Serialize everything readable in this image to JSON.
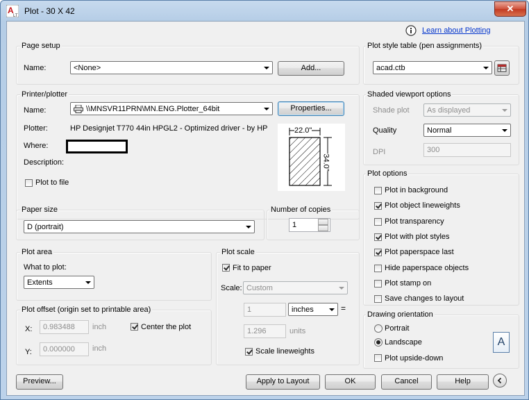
{
  "window": {
    "title": "Plot - 30 X 42",
    "close_glyph": "✕"
  },
  "help_link": "Learn about Plotting",
  "page_setup": {
    "group_label": "Page setup",
    "name_label": "Name:",
    "name_value": "<None>",
    "add_button": "Add..."
  },
  "printer": {
    "group_label": "Printer/plotter",
    "name_label": "Name:",
    "name_value": "\\\\MNSVR11PRN\\MN.ENG.Plotter_64bit",
    "properties_button": "Properties...",
    "plotter_label": "Plotter:",
    "plotter_value": "HP Designjet T770 44in HPGL2 - Optimized driver - by HP",
    "where_label": "Where:",
    "description_label": "Description:",
    "plot_to_file_label": "Plot to file",
    "plot_to_file_checked": false,
    "preview_width": "22.0\"",
    "preview_height": "34.0\""
  },
  "paper_size": {
    "group_label": "Paper size",
    "value": "D (portrait)"
  },
  "copies": {
    "group_label": "Number of copies",
    "value": "1"
  },
  "plot_area": {
    "group_label": "Plot area",
    "what_label": "What to plot:",
    "value": "Extents"
  },
  "plot_offset": {
    "group_label": "Plot offset (origin set to printable area)",
    "x_label": "X:",
    "x_value": "0.983488",
    "x_unit": "inch",
    "y_label": "Y:",
    "y_value": "0.000000",
    "y_unit": "inch",
    "center_label": "Center the plot",
    "center_checked": true
  },
  "plot_scale": {
    "group_label": "Plot scale",
    "fit_label": "Fit to paper",
    "fit_checked": true,
    "scale_label": "Scale:",
    "scale_value": "Custom",
    "num_value": "1",
    "unit_value": "inches",
    "equals": "=",
    "den_value": "1.296",
    "den_unit": "units",
    "lineweights_label": "Scale lineweights",
    "lineweights_checked": true
  },
  "plot_style": {
    "group_label": "Plot style table (pen assignments)",
    "value": "acad.ctb"
  },
  "shaded": {
    "group_label": "Shaded viewport options",
    "shade_label": "Shade plot",
    "shade_value": "As displayed",
    "quality_label": "Quality",
    "quality_value": "Normal",
    "dpi_label": "DPI",
    "dpi_value": "300"
  },
  "plot_options": {
    "group_label": "Plot options",
    "items": [
      {
        "label": "Plot in background",
        "checked": false
      },
      {
        "label": "Plot object lineweights",
        "checked": true
      },
      {
        "label": "Plot transparency",
        "checked": false
      },
      {
        "label": "Plot with plot styles",
        "checked": true
      },
      {
        "label": "Plot paperspace last",
        "checked": true
      },
      {
        "label": "Hide paperspace objects",
        "checked": false
      },
      {
        "label": "Plot stamp on",
        "checked": false
      },
      {
        "label": "Save changes to layout",
        "checked": false
      }
    ]
  },
  "orientation": {
    "group_label": "Drawing orientation",
    "portrait_label": "Portrait",
    "landscape_label": "Landscape",
    "selected": "Landscape",
    "upside_label": "Plot upside-down",
    "upside_checked": false,
    "icon_letter": "A"
  },
  "buttons": {
    "preview": "Preview...",
    "apply": "Apply to Layout",
    "ok": "OK",
    "cancel": "Cancel",
    "help": "Help"
  },
  "colors": {
    "link": "#0033cc",
    "client_bg": "#f0f0f0",
    "frame": "#bcd2ea"
  }
}
